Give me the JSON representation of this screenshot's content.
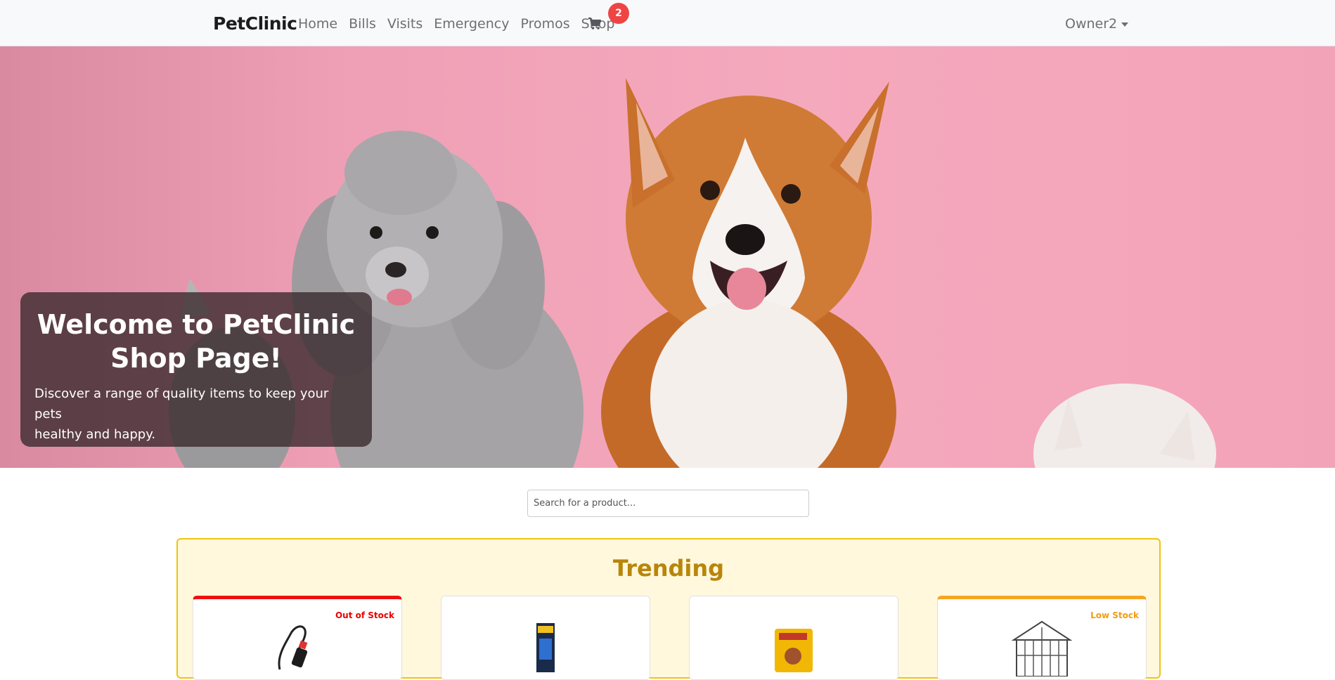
{
  "navbar": {
    "brand": "PetClinic",
    "links": [
      "Home",
      "Bills",
      "Visits",
      "Emergency",
      "Promos",
      "Shop"
    ],
    "cart_count": "2",
    "user": "Owner2"
  },
  "hero": {
    "title_line1": "Welcome to PetClinic",
    "title_line2": "Shop Page!",
    "text_line1": "Discover a range of quality items to keep your pets",
    "text_line2": "healthy and happy."
  },
  "search": {
    "placeholder": "Search for a product..."
  },
  "trending": {
    "title": "Trending",
    "products": [
      {
        "stock_label": "Out of Stock",
        "icon": "cable-product-icon"
      },
      {
        "stock_label": "",
        "icon": "boxed-product-icon"
      },
      {
        "stock_label": "",
        "icon": "dog-food-bag-icon"
      },
      {
        "stock_label": "Low Stock",
        "icon": "pet-cage-icon"
      }
    ]
  },
  "colors": {
    "out_of_stock": "#e11111",
    "low_stock": "#f5a623",
    "trending_border": "#f1c40f",
    "badge": "#ef4444"
  }
}
